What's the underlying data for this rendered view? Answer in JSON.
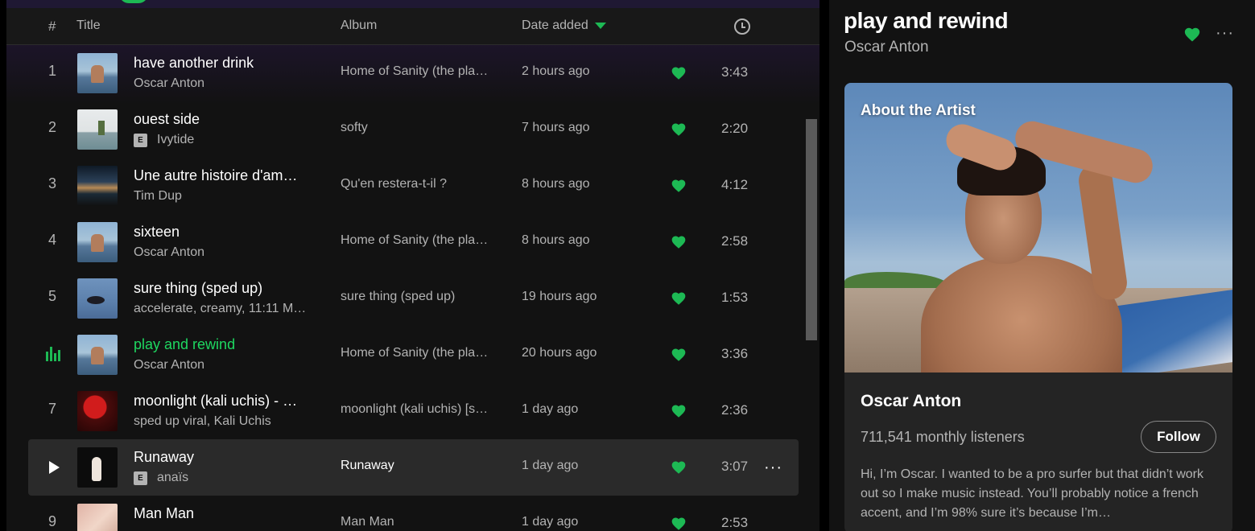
{
  "colors": {
    "accent": "#1db954",
    "background": "#121212",
    "text_muted": "#b3b3b3"
  },
  "tracklist": {
    "header": {
      "num": "#",
      "title": "Title",
      "album": "Album",
      "date_added": "Date added",
      "duration_icon": "clock-icon"
    },
    "rows": [
      {
        "num": "1",
        "title": "have another drink",
        "artist": "Oscar Anton",
        "explicit": false,
        "album": "Home of Sanity (the pla…",
        "date": "2 hours ago",
        "duration": "3:43",
        "liked": true,
        "thumb": "sky"
      },
      {
        "num": "2",
        "title": "ouest side",
        "artist": "Ivytide",
        "explicit": true,
        "album": "softy",
        "date": "7 hours ago",
        "duration": "2:20",
        "liked": true,
        "thumb": "white"
      },
      {
        "num": "3",
        "title": "Une autre histoire d'am…",
        "artist": "Tim Dup",
        "explicit": false,
        "album": "Qu'en restera-t-il ?",
        "date": "8 hours ago",
        "duration": "4:12",
        "liked": true,
        "thumb": "dusk"
      },
      {
        "num": "4",
        "title": "sixteen",
        "artist": "Oscar Anton",
        "explicit": false,
        "album": "Home of Sanity (the pla…",
        "date": "8 hours ago",
        "duration": "2:58",
        "liked": true,
        "thumb": "sky"
      },
      {
        "num": "5",
        "title": "sure thing (sped up)",
        "artist": "accelerate, creamy, 11:11 M…",
        "explicit": false,
        "album": "sure thing (sped up)",
        "date": "19 hours ago",
        "duration": "1:53",
        "liked": true,
        "thumb": "water"
      },
      {
        "num": "6",
        "title": "play and rewind",
        "artist": "Oscar Anton",
        "explicit": false,
        "album": "Home of Sanity (the pla…",
        "date": "20 hours ago",
        "duration": "3:36",
        "liked": true,
        "thumb": "sky",
        "playing": true
      },
      {
        "num": "7",
        "title": "moonlight (kali uchis) - …",
        "artist": "sped up viral, Kali Uchis",
        "explicit": false,
        "album": "moonlight (kali uchis) [s…",
        "date": "1 day ago",
        "duration": "2:36",
        "liked": true,
        "thumb": "red"
      },
      {
        "num": "8",
        "title": "Runaway",
        "artist": "anaïs",
        "explicit": true,
        "album": "Runaway",
        "date": "1 day ago",
        "duration": "3:07",
        "liked": true,
        "thumb": "dark",
        "hover": true
      },
      {
        "num": "9",
        "title": "Man Man",
        "artist": "",
        "explicit": false,
        "album": "Man Man",
        "date": "1 day ago",
        "duration": "2:53",
        "liked": true,
        "thumb": "pink"
      }
    ],
    "explicit_label": "E",
    "more_label": "···"
  },
  "now_playing": {
    "title": "play and rewind",
    "artist": "Oscar Anton",
    "more_label": "···",
    "about": {
      "label": "About the Artist",
      "artist_name": "Oscar Anton",
      "listeners": "711,541 monthly listeners",
      "follow_label": "Follow",
      "bio": "Hi, I’m Oscar. I wanted to be a pro surfer but that didn’t work out so I make music instead. You’ll probably notice a french accent, and I’m 98% sure it’s because I’m…"
    }
  }
}
